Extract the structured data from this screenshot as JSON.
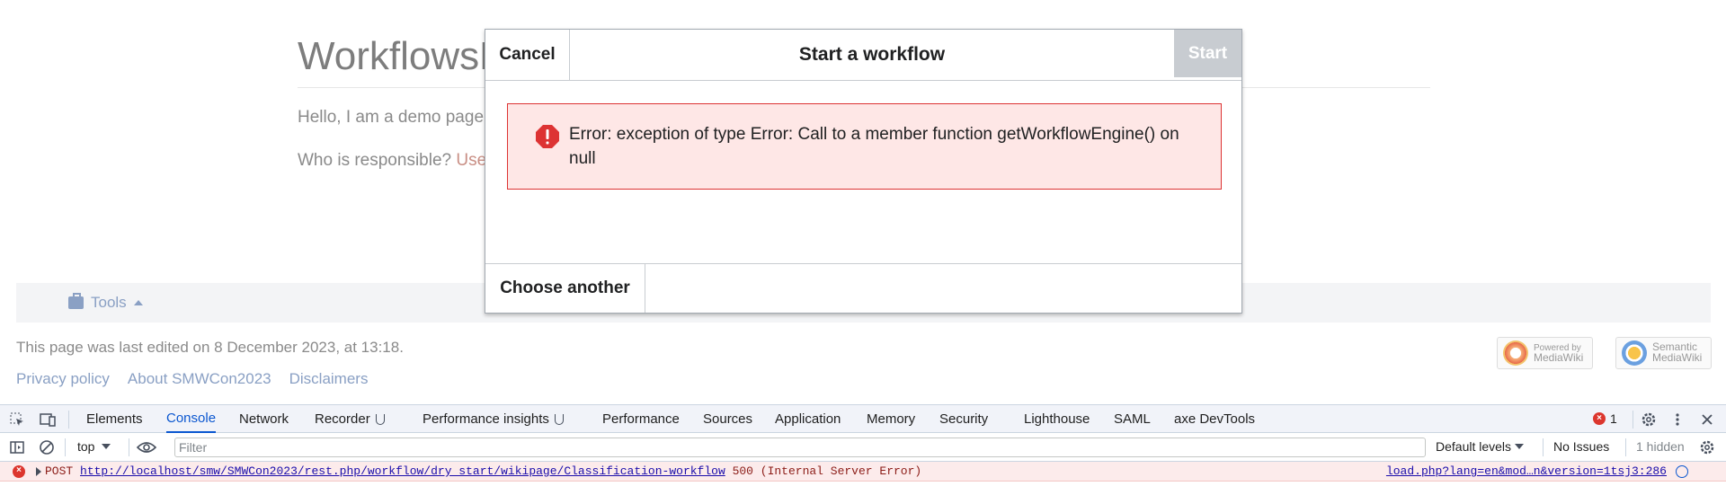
{
  "page": {
    "title": "WorkflowsD",
    "intro": "Hello, I am a demo page",
    "responsible_label": "Who is responsible?",
    "responsible_link": "Use",
    "tools_label": "Tools",
    "last_edited": "This page was last edited on 8 December 2023, at 13:18.",
    "footer_links": [
      "Privacy policy",
      "About SMWCon2023",
      "Disclaimers"
    ],
    "badges": [
      {
        "line1": "Powered by",
        "line2": "MediaWiki"
      },
      {
        "line1": "Semantic",
        "line2": "MediaWiki"
      }
    ]
  },
  "dialog": {
    "cancel_label": "Cancel",
    "title": "Start a workflow",
    "start_label": "Start",
    "error_message": "Error: exception of type Error: Call to a member function getWorkflowEngine() on null",
    "choose_another_label": "Choose another"
  },
  "devtools": {
    "tabs": [
      "Elements",
      "Console",
      "Network",
      "Recorder",
      "Performance insights",
      "Performance",
      "Sources",
      "Application",
      "Memory",
      "Security",
      "Lighthouse",
      "SAML",
      "axe DevTools"
    ],
    "active_tab": "Console",
    "error_count": "1",
    "context": "top",
    "filter_placeholder": "Filter",
    "levels": "Default levels",
    "issues": "No Issues",
    "hidden": "1 hidden",
    "console_message": {
      "method": "POST",
      "url": "http://localhost/smw/SMWCon2023/rest.php/workflow/dry_start/wikipage/Classification-workflow",
      "status": "500 (Internal Server Error)",
      "source": "load.php?lang=en&mod…n&version=1tsj3:286"
    }
  },
  "colors": {
    "error_bg": "#fee7e6",
    "error_border": "#dd3333",
    "devtools_accent": "#0b57d0",
    "disabled_button": "#c8ccd1"
  }
}
